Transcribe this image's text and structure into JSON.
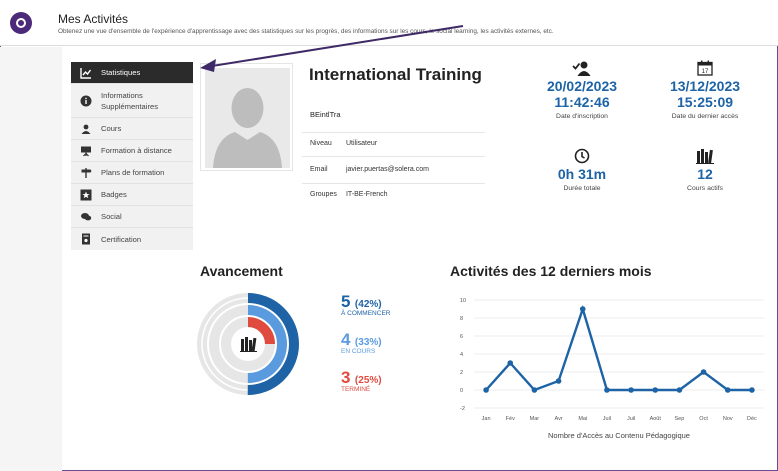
{
  "header": {
    "title": "Mes Activités",
    "subtitle": "Obtenez une vue d'ensemble de l'expérience d'apprentissage avec des statistiques sur les progrès, des informations sur les cours, le social learning, les activités externes, etc."
  },
  "menu": {
    "items": [
      {
        "label": "Statistiques",
        "icon": "chart-line-icon",
        "active": true
      },
      {
        "label": "Informations\nSupplémentaires",
        "icon": "info-circle-icon"
      },
      {
        "label": "Cours",
        "icon": "users-icon"
      },
      {
        "label": "Formation à distance",
        "icon": "presentation-icon"
      },
      {
        "label": "Plans de formation",
        "icon": "signpost-icon"
      },
      {
        "label": "Badges",
        "icon": "star-icon"
      },
      {
        "label": "Social",
        "icon": "chat-icon"
      },
      {
        "label": "Certification",
        "icon": "certificate-icon"
      }
    ]
  },
  "profile": {
    "name": "International Training",
    "username": "BEintlTra",
    "rows": [
      {
        "label": "Niveau",
        "value": "Utilisateur"
      },
      {
        "label": "Email",
        "value": "javier.puertas@solera.com"
      },
      {
        "label": "Groupes",
        "value": "IT-BE-French"
      }
    ]
  },
  "stats": {
    "registration": {
      "date": "20/02/2023",
      "time": "11:42:46",
      "label": "Date d'inscription"
    },
    "last_access": {
      "date": "13/12/2023",
      "time": "15:25:09",
      "label": "Date du dernier accès",
      "calendar_day": "17"
    },
    "total_duration": {
      "value": "0h 31m",
      "label": "Durée totale"
    },
    "active_courses": {
      "value": "12",
      "label": "Cours actifs"
    }
  },
  "progress": {
    "title": "Avancement",
    "items": [
      {
        "count": "5",
        "pct": "(42%)",
        "label": "À COMMENCER",
        "color": "#1d63a6",
        "fraction": 0.42
      },
      {
        "count": "4",
        "pct": "(33%)",
        "label": "EN COURS",
        "color": "#5a9be0",
        "fraction": 0.33
      },
      {
        "count": "3",
        "pct": "(25%)",
        "label": "TERMINÉ",
        "color": "#e04b3f",
        "fraction": 0.25
      }
    ]
  },
  "activity": {
    "title": "Activités des 12 derniers mois"
  },
  "chart_data": {
    "type": "line",
    "categories": [
      "Jan",
      "Fév",
      "Mar",
      "Avr",
      "Mai",
      "Juil",
      "Juil",
      "Août",
      "Sep",
      "Oct",
      "Nov",
      "Déc"
    ],
    "values": [
      0,
      3,
      0,
      1,
      9,
      0,
      0,
      0,
      0,
      2,
      0,
      0
    ],
    "ylim": [
      -2,
      10
    ],
    "yticks": [
      "10",
      "8",
      "6",
      "4",
      "2",
      "0",
      "-2"
    ],
    "xlabel": "Nombre d'Accès au Contenu Pédagogique",
    "ylabel": "",
    "grid": true,
    "color": "#1d63a6"
  }
}
